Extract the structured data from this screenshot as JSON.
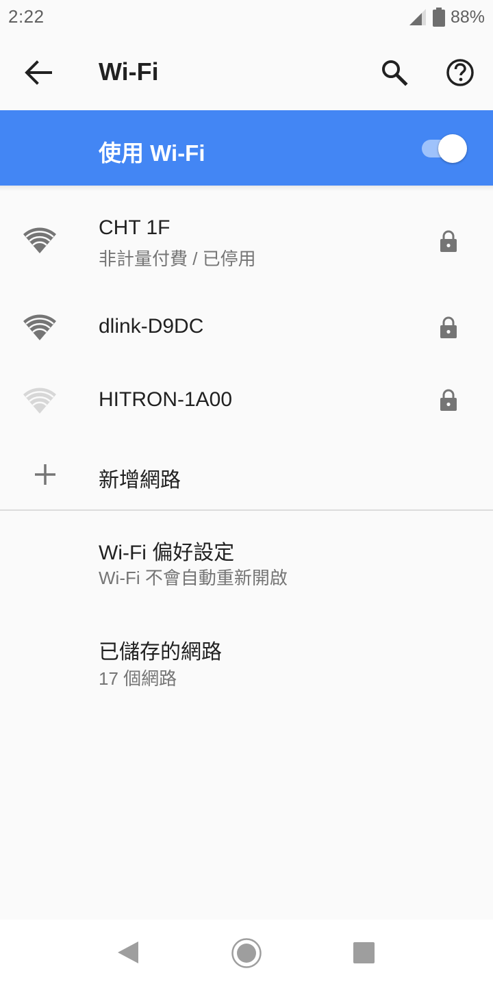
{
  "status_bar": {
    "time": "2:22",
    "battery_percent": "88%",
    "signal_icon": "cell-signal-icon",
    "battery_icon": "battery-icon"
  },
  "toolbar": {
    "title": "Wi-Fi",
    "back_icon": "arrow-back-icon",
    "search_icon": "search-icon",
    "help_icon": "help-icon"
  },
  "master_switch": {
    "label": "使用 Wi-Fi",
    "enabled": true,
    "accent_color": "#4386f4"
  },
  "networks": [
    {
      "ssid": "CHT 1F",
      "status": "非計量付費 / 已停用",
      "signal": "strong",
      "secured": true
    },
    {
      "ssid": "dlink-D9DC",
      "status": "",
      "signal": "strong",
      "secured": true
    },
    {
      "ssid": "HITRON-1A00",
      "status": "",
      "signal": "weak",
      "secured": true
    }
  ],
  "add_network": {
    "label": "新增網路",
    "icon": "add-icon"
  },
  "preferences": {
    "title": "Wi-Fi 偏好設定",
    "summary": "Wi-Fi 不會自動重新開啟"
  },
  "saved_networks": {
    "title": "已儲存的網路",
    "summary": "17 個網路"
  },
  "nav_bar": {
    "back_icon": "nav-back-icon",
    "home_icon": "nav-home-icon",
    "recents_icon": "nav-recents-icon"
  }
}
